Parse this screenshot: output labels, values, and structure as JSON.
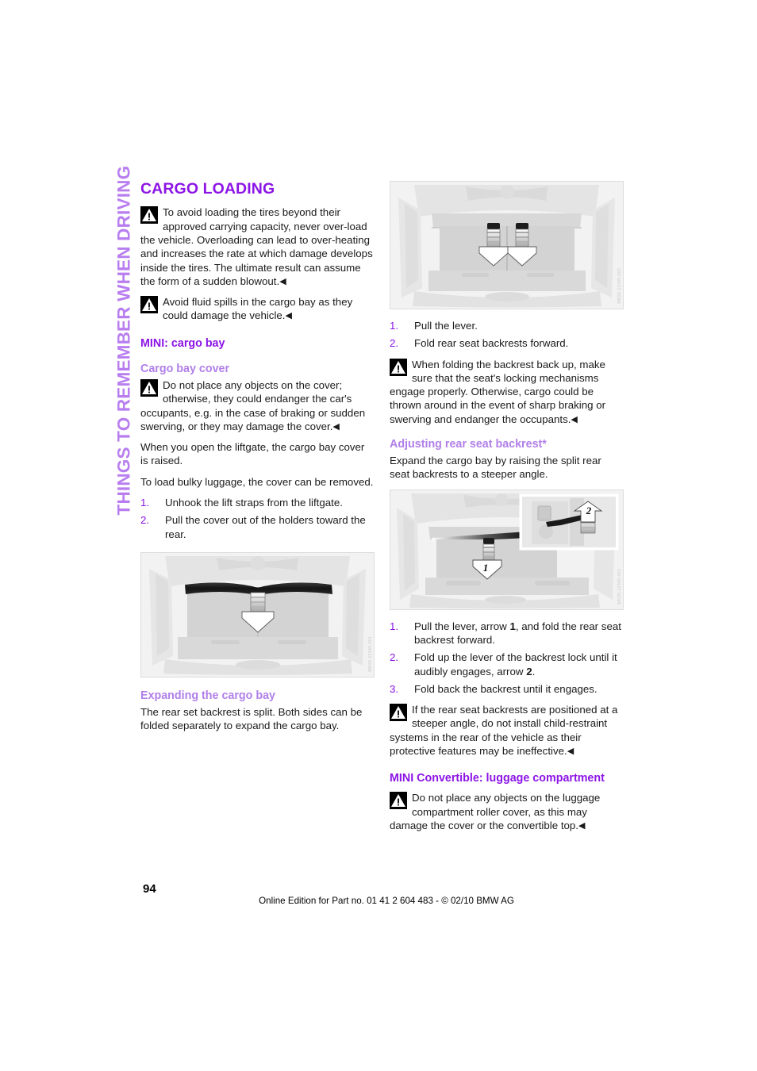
{
  "running_head": "THINGS TO REMEMBER WHEN DRIVING",
  "colors": {
    "heading_purple": "#8c14e6",
    "subheading_lavender": "#b17fe8",
    "running_head_lavender": "#b87ef0",
    "list_number": "#8c14e6"
  },
  "chapter_title": "CARGO LOADING",
  "left_column": {
    "warning_1": "To avoid loading the tires beyond their approved carrying capacity, never over-load the vehicle. Overloading can lead to over-heating and increases the rate at which damage develops inside the tires. The ultimate result can assume the form of a sudden blowout.",
    "warning_2": "Avoid fluid spills in the cargo bay as they could damage the vehicle.",
    "section_mini_cargo_bay": "MINI: cargo bay",
    "subsection_cargo_bay_cover": "Cargo bay cover",
    "warning_3": "Do not place any objects on the cover; otherwise, they could endanger the car's occupants, e.g. in the case of braking or sudden swerving, or they may damage the cover.",
    "para_1": "When you open the liftgate, the cargo bay cover is raised.",
    "para_2": "To load bulky luggage, the cover can be removed.",
    "steps": [
      "Unhook the lift straps from the liftgate.",
      "Pull the cover out of the holders toward the rear."
    ],
    "figure_cargo_bay_cover": {
      "caption_code": "MN20-12345-001",
      "alt": "Rear cargo bay of MINI with cargo bay cover and downward white arrow"
    },
    "subsection_expanding": "Expanding the cargo bay",
    "para_3": "The rear set backrest is split. Both sides can be folded separately to expand the cargo bay."
  },
  "right_column": {
    "figure_fold_backrests": {
      "caption_code": "MN20-12345-002",
      "alt": "Rear cargo bay with two downward arrows on split rear seat backrests"
    },
    "steps_fold": [
      "Pull the lever.",
      "Fold rear seat backrests forward."
    ],
    "warning_4": "When folding the backrest back up, make sure that the seat's locking mechanisms engage properly. Otherwise, cargo could be thrown around in the event of sharp braking or swerving and endanger the occupants.",
    "subsection_adjusting": "Adjusting rear seat backrest*",
    "para_4": "Expand the cargo bay by raising the split rear seat backrests to a steeper angle.",
    "figure_adjusting": {
      "caption_code": "MN20-12345-003",
      "label_1": "1",
      "label_2": "2",
      "alt": "Cargo bay with arrow 1 on backrest lever and inset detail with arrow 2 on backrest lock"
    },
    "steps_adjust": [
      {
        "pre": "Pull the lever, arrow ",
        "bold": "1",
        "post": ", and fold the rear seat backrest forward."
      },
      {
        "pre": "Fold up the lever of the backrest lock until it audibly engages, arrow ",
        "bold": "2",
        "post": "."
      },
      {
        "pre": "Fold back the backrest until it engages.",
        "bold": "",
        "post": ""
      }
    ],
    "warning_5": "If the rear seat backrests are positioned at a steeper angle, do not install child-restraint systems in the rear of the vehicle as their protective features may be ineffective.",
    "section_mini_convertible": "MINI Convertible: luggage compartment",
    "warning_6": "Do not place any objects on the luggage compartment roller cover, as this may damage the cover or the convertible top."
  },
  "footer": {
    "page_number": "94",
    "note": "Online Edition for Part no. 01 41 2 604 483 - © 02/10  BMW AG"
  },
  "icons": {
    "warning_triangle": "warning-triangle-icon",
    "end_of_message": "◀"
  }
}
